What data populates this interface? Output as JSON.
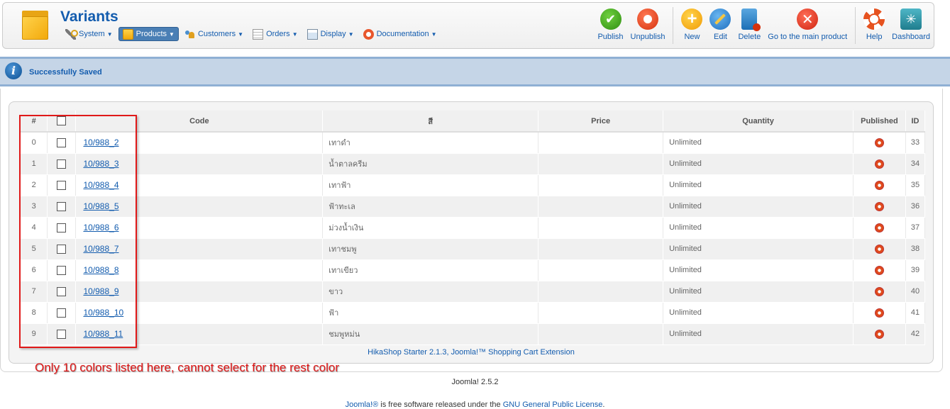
{
  "header": {
    "title": "Variants",
    "menu": [
      {
        "label": "System",
        "icon": "wrench-icon"
      },
      {
        "label": "Products",
        "icon": "box-icon",
        "active": true
      },
      {
        "label": "Customers",
        "icon": "users-icon"
      },
      {
        "label": "Orders",
        "icon": "orders-icon"
      },
      {
        "label": "Display",
        "icon": "display-icon"
      },
      {
        "label": "Documentation",
        "icon": "lifebuoy-icon"
      }
    ],
    "toolbar": {
      "publish": "Publish",
      "unpublish": "Unpublish",
      "new": "New",
      "edit": "Edit",
      "delete": "Delete",
      "main_product": "Go to the main product",
      "help": "Help",
      "dashboard": "Dashboard"
    }
  },
  "message": {
    "text": "Successfully Saved",
    "icon": "info-icon"
  },
  "table": {
    "headers": {
      "num": "#",
      "code": "Code",
      "color": "สี",
      "price": "Price",
      "quantity": "Quantity",
      "published": "Published",
      "id": "ID"
    },
    "rows": [
      {
        "num": "0",
        "code": "10/988_2",
        "color": "เทาดำ",
        "price": "",
        "quantity": "Unlimited",
        "id": "33"
      },
      {
        "num": "1",
        "code": "10/988_3",
        "color": "น้ำตาลครีม",
        "price": "",
        "quantity": "Unlimited",
        "id": "34"
      },
      {
        "num": "2",
        "code": "10/988_4",
        "color": "เทาฟ้า",
        "price": "",
        "quantity": "Unlimited",
        "id": "35"
      },
      {
        "num": "3",
        "code": "10/988_5",
        "color": "ฟ้าทะเล",
        "price": "",
        "quantity": "Unlimited",
        "id": "36"
      },
      {
        "num": "4",
        "code": "10/988_6",
        "color": "ม่วงน้ำเงิน",
        "price": "",
        "quantity": "Unlimited",
        "id": "37"
      },
      {
        "num": "5",
        "code": "10/988_7",
        "color": "เทาชมพู",
        "price": "",
        "quantity": "Unlimited",
        "id": "38"
      },
      {
        "num": "6",
        "code": "10/988_8",
        "color": "เทาเขียว",
        "price": "",
        "quantity": "Unlimited",
        "id": "39"
      },
      {
        "num": "7",
        "code": "10/988_9",
        "color": "ขาว",
        "price": "",
        "quantity": "Unlimited",
        "id": "40"
      },
      {
        "num": "8",
        "code": "10/988_10",
        "color": "ฟ้า",
        "price": "",
        "quantity": "Unlimited",
        "id": "41"
      },
      {
        "num": "9",
        "code": "10/988_11",
        "color": "ชมพูหม่น",
        "price": "",
        "quantity": "Unlimited",
        "id": "42"
      }
    ]
  },
  "panel_footer": "HikaShop Starter 2.1.3, Joomla!™ Shopping Cart Extension",
  "annotation": "Only 10 colors listed here, cannot select for the rest color",
  "footer": {
    "version": "Joomla! 2.5.2",
    "license_prefix": "Joomla!®",
    "license_mid": " is free software released under the ",
    "license_link": "GNU General Public License",
    "license_suffix": "."
  },
  "colors": {
    "link": "#135cae",
    "annotation_red": "#e01818",
    "message_bg": "#c5d5e7"
  }
}
